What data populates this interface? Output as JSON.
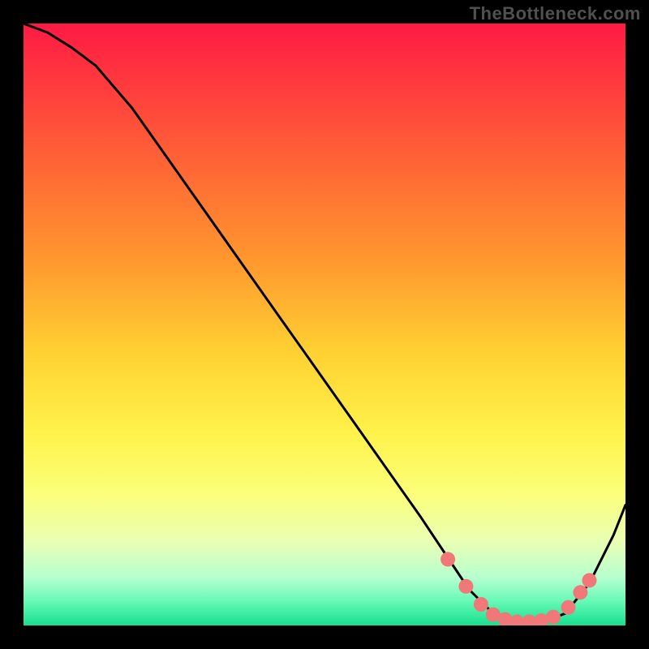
{
  "watermark": "TheBottleneck.com",
  "colors": {
    "bg_black": "#000000",
    "marker": "#f07878",
    "curve": "#000000"
  },
  "chart_data": {
    "type": "line",
    "title": "",
    "xlabel": "",
    "ylabel": "",
    "xlim": [
      0,
      100
    ],
    "ylim": [
      0,
      100
    ],
    "grid": false,
    "gradient_stops": [
      {
        "offset": 0.0,
        "color": "#ff1a44"
      },
      {
        "offset": 0.1,
        "color": "#ff3a3e"
      },
      {
        "offset": 0.25,
        "color": "#ff6a34"
      },
      {
        "offset": 0.4,
        "color": "#ff9a2e"
      },
      {
        "offset": 0.55,
        "color": "#ffd233"
      },
      {
        "offset": 0.68,
        "color": "#fff24a"
      },
      {
        "offset": 0.78,
        "color": "#fcff7a"
      },
      {
        "offset": 0.86,
        "color": "#e9ffb3"
      },
      {
        "offset": 0.92,
        "color": "#b7ffcf"
      },
      {
        "offset": 0.96,
        "color": "#66f9b6"
      },
      {
        "offset": 1.0,
        "color": "#16e08e"
      }
    ],
    "series": [
      {
        "name": "curve",
        "x": [
          0,
          4,
          8,
          12,
          18,
          24,
          30,
          36,
          42,
          48,
          54,
          60,
          66,
          70,
          74,
          78,
          82,
          86,
          90,
          94,
          98,
          100
        ],
        "y": [
          100,
          98.5,
          96,
          93,
          86,
          77.5,
          69,
          60.5,
          52,
          43.5,
          35,
          26.5,
          18,
          12,
          6,
          2,
          0.5,
          0.5,
          2,
          7,
          15,
          20
        ]
      }
    ],
    "markers": {
      "name": "highlight-points",
      "x": [
        70.5,
        73.5,
        76.0,
        78.0,
        80.0,
        82.0,
        84.0,
        86.0,
        88.0,
        90.5,
        92.5,
        94.0
      ],
      "y": [
        11.0,
        6.5,
        3.5,
        1.8,
        1.0,
        0.6,
        0.6,
        0.8,
        1.4,
        3.0,
        5.5,
        7.5
      ]
    }
  }
}
